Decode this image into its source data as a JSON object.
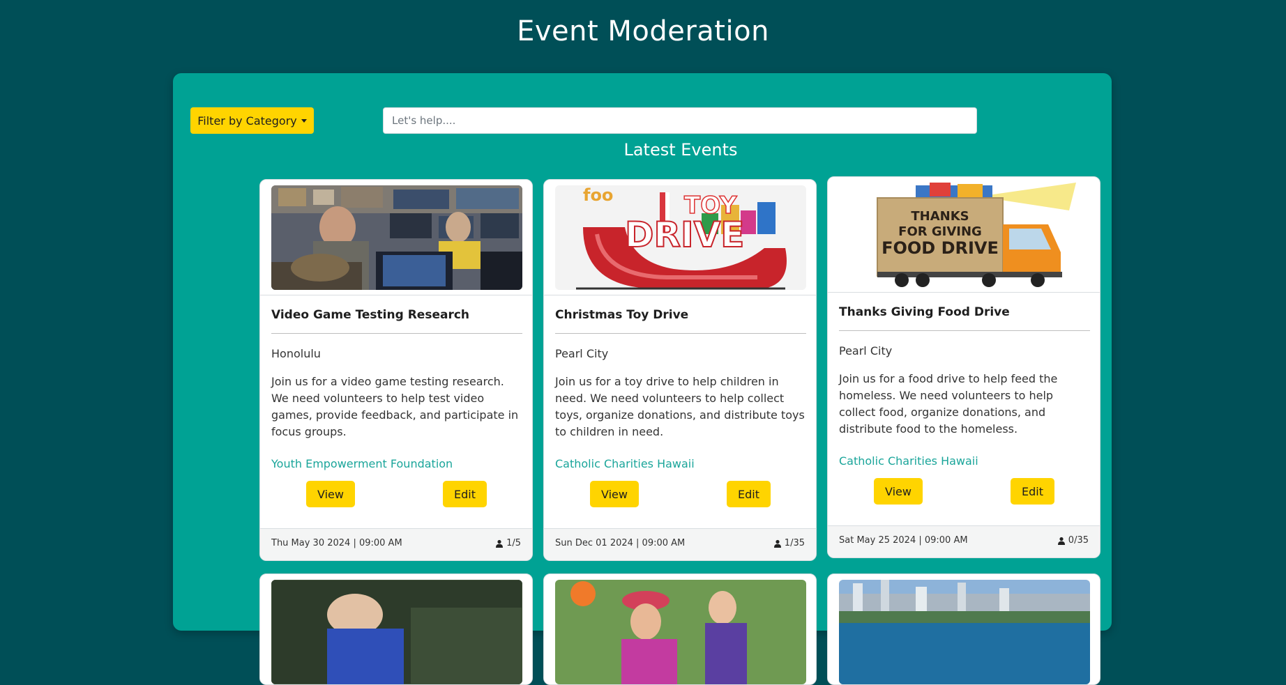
{
  "page": {
    "title": "Event Moderation"
  },
  "toolbar": {
    "filter_label": "Filter by Category",
    "search_placeholder": "Let's help....",
    "search_value": ""
  },
  "section": {
    "title": "Latest Events"
  },
  "colors": {
    "background": "#004f57",
    "panel": "#00a294",
    "accent": "#ffd400",
    "link": "#1aa59a"
  },
  "events": [
    {
      "title": "Video Game Testing Research",
      "location": "Honolulu",
      "description": "Join us for a video game testing research. We need volunteers to help test video games, provide feedback, and participate in focus groups.",
      "organization": "Youth Empowerment Foundation",
      "view_label": "View",
      "edit_label": "Edit",
      "date": "Thu May 30 2024 | 09:00 AM",
      "volunteers": "1/5"
    },
    {
      "title": "Christmas Toy Drive",
      "location": "Pearl City",
      "description": "Join us for a toy drive to help children in need. We need volunteers to help collect toys, organize donations, and distribute toys to children in need.",
      "organization": "Catholic Charities Hawaii",
      "view_label": "View",
      "edit_label": "Edit",
      "date": "Sun Dec 01 2024 | 09:00 AM",
      "volunteers": "1/35",
      "image_text": [
        "foo",
        "TOY",
        "DRIVE"
      ]
    },
    {
      "title": "Thanks Giving Food Drive",
      "location": "Pearl City",
      "description": "Join us for a food drive to help feed the homeless. We need volunteers to help collect food, organize donations, and distribute food to the homeless.",
      "organization": "Catholic Charities Hawaii",
      "view_label": "View",
      "edit_label": "Edit",
      "date": "Sat May 25 2024 | 09:00 AM",
      "volunteers": "0/35",
      "image_text": [
        "THANKS",
        "FOR GIVING",
        "FOOD DRIVE"
      ]
    }
  ]
}
